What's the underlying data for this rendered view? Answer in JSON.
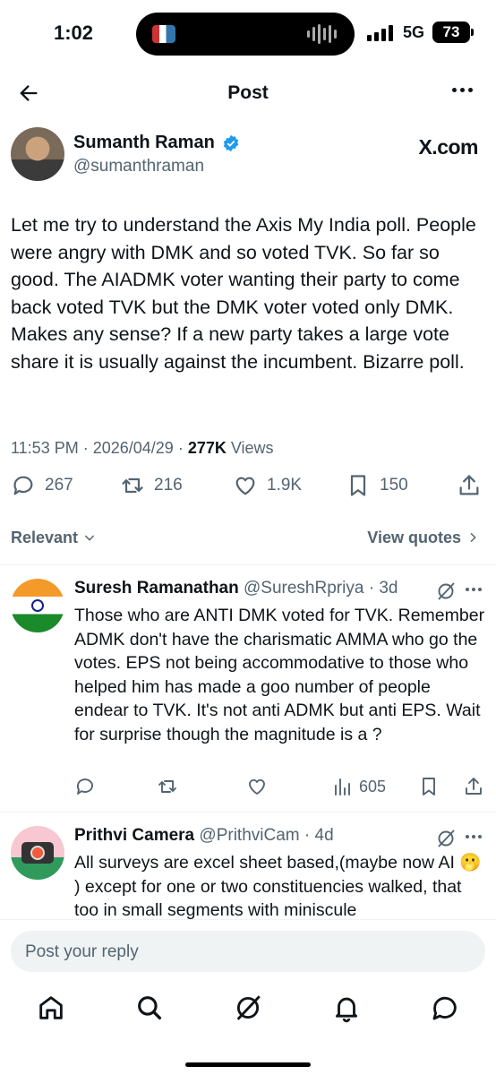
{
  "status_bar": {
    "time": "1:02",
    "network": "5G",
    "battery": "73"
  },
  "header": {
    "title": "Post"
  },
  "post": {
    "author_name": "Sumanth Raman",
    "author_handle": "@sumanthraman",
    "source_mark": "X.com",
    "text": "Let me try to understand the Axis My India poll. People were angry with DMK and so voted TVK. So far so good. The AIADMK voter wanting their party to come back voted TVK but the DMK voter voted only DMK. Makes any sense? If a new party takes a large vote share it is usually against the incumbent. Bizarre poll.",
    "time": "11:53 PM",
    "date": "2026/04/29",
    "views_count": "277K",
    "views_label": "Views",
    "replies": "267",
    "reposts": "216",
    "likes": "1.9K",
    "bookmarks": "150"
  },
  "filters": {
    "sort_label": "Relevant",
    "view_quotes": "View quotes"
  },
  "replies": [
    {
      "name": "Suresh Ramanathan",
      "handle": "@SureshRpriya",
      "age": "3d",
      "text": "Those who are ANTI DMK voted for TVK. Remember ADMK don't have the charismatic AMMA who go the votes. EPS not being accommodative to those who helped him has made a goo number of people endear to TVK. It's not anti ADMK but anti EPS. Wait for surprise though the magnitude is a ?",
      "views": "605"
    },
    {
      "name": "Prithvi Camera",
      "handle": "@PrithviCam",
      "age": "4d",
      "text": "All surveys are excel sheet based,(maybe now AI 🫢 ) except for one or two constituencies walked, that too in small segments with miniscule"
    }
  ],
  "compose": {
    "placeholder": "Post your reply"
  },
  "colors": {
    "text": "#0f1419",
    "secondary": "#536471",
    "verified": "#1d9bf0",
    "divider": "#eff3f4"
  },
  "icons": [
    "back-arrow-icon",
    "more-icon",
    "verified-badge-icon",
    "reply-icon",
    "repost-icon",
    "like-icon",
    "bookmark-icon",
    "share-icon",
    "chevron-down-icon",
    "chevron-right-icon",
    "grok-icon",
    "views-icon",
    "home-icon",
    "search-icon",
    "notifications-icon",
    "messages-icon"
  ]
}
